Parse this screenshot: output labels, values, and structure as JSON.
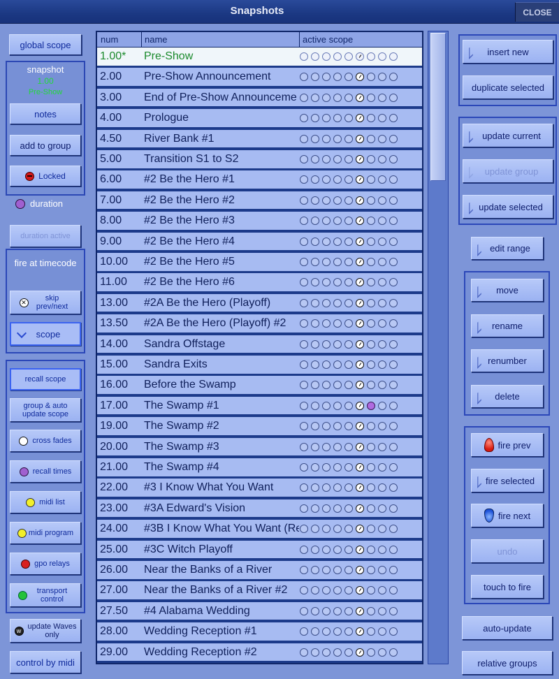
{
  "window": {
    "title": "Snapshots",
    "close_label": "CLOSE"
  },
  "left": {
    "global_scope": "global scope",
    "snapshot_label": "snapshot",
    "snapshot_number": "1.00",
    "snapshot_name": "Pre-Show",
    "notes": "notes",
    "add_to_group": "add to group",
    "locked": "Locked",
    "duration": "duration",
    "duration_active": "duration active",
    "fire_at_timecode": "fire at timecode",
    "skip_prev_next": "skip prev/next",
    "scope": "scope",
    "recall_scope": "recall scope",
    "group_auto_update_scope": "group & auto update scope",
    "cross_fades": "cross fades",
    "recall_times": "recall times",
    "midi_list": "midi list",
    "midi_program": "midi program",
    "gpo_relays": "gpo relays",
    "transport_control": "transport control",
    "update_waves_only": "update Waves only",
    "control_by_midi": "control by midi"
  },
  "table": {
    "headers": {
      "num": "num",
      "name": "name",
      "active_scope": "active scope"
    },
    "rows": [
      {
        "num": "1.00*",
        "name": "Pre-Show"
      },
      {
        "num": "2.00",
        "name": "Pre-Show Announcement"
      },
      {
        "num": "3.00",
        "name": "End of Pre-Show Announceme"
      },
      {
        "num": "4.00",
        "name": "Prologue"
      },
      {
        "num": "4.50",
        "name": "River Bank #1"
      },
      {
        "num": "5.00",
        "name": "Transition S1 to S2"
      },
      {
        "num": "6.00",
        "name": "#2 Be the Hero #1"
      },
      {
        "num": "7.00",
        "name": "#2 Be the Hero #2"
      },
      {
        "num": "8.00",
        "name": "#2 Be the Hero #3"
      },
      {
        "num": "9.00",
        "name": "#2 Be the Hero #4"
      },
      {
        "num": "10.00",
        "name": "#2 Be the Hero #5"
      },
      {
        "num": "11.00",
        "name": "#2 Be the Hero #6"
      },
      {
        "num": "13.00",
        "name": "#2A Be the Hero (Playoff)"
      },
      {
        "num": "13.50",
        "name": "#2A Be the Hero (Playoff) #2"
      },
      {
        "num": "14.00",
        "name": "Sandra Offstage"
      },
      {
        "num": "15.00",
        "name": "Sandra Exits"
      },
      {
        "num": "16.00",
        "name": "Before the Swamp"
      },
      {
        "num": "17.00",
        "name": "The Swamp #1"
      },
      {
        "num": "19.00",
        "name": "The Swamp #2"
      },
      {
        "num": "20.00",
        "name": "The Swamp #3"
      },
      {
        "num": "21.00",
        "name": "The Swamp #4"
      },
      {
        "num": "22.00",
        "name": "#3 I Know What You Want"
      },
      {
        "num": "23.00",
        "name": "#3A Edward's Vision"
      },
      {
        "num": "24.00",
        "name": "#3B I Know What You Want (Re"
      },
      {
        "num": "25.00",
        "name": "#3C Witch Playoff"
      },
      {
        "num": "26.00",
        "name": "Near the Banks of a River"
      },
      {
        "num": "27.00",
        "name": "Near the Banks of a River #2"
      },
      {
        "num": "27.50",
        "name": "#4 Alabama Wedding"
      },
      {
        "num": "28.00",
        "name": "Wedding Reception #1"
      },
      {
        "num": "29.00",
        "name": "Wedding Reception #2"
      }
    ]
  },
  "right": {
    "insert_new": "insert new",
    "duplicate_selected": "duplicate selected",
    "update_current": "update current",
    "update_group": "update group",
    "update_selected": "update selected",
    "edit_range": "edit range",
    "move": "move",
    "rename": "rename",
    "renumber": "renumber",
    "delete": "delete",
    "fire_prev": "fire prev",
    "fire_selected": "fire selected",
    "fire_next": "fire next",
    "undo": "undo",
    "touch_to_fire": "touch to fire",
    "auto_update": "auto-update",
    "relative_groups": "relative groups"
  }
}
